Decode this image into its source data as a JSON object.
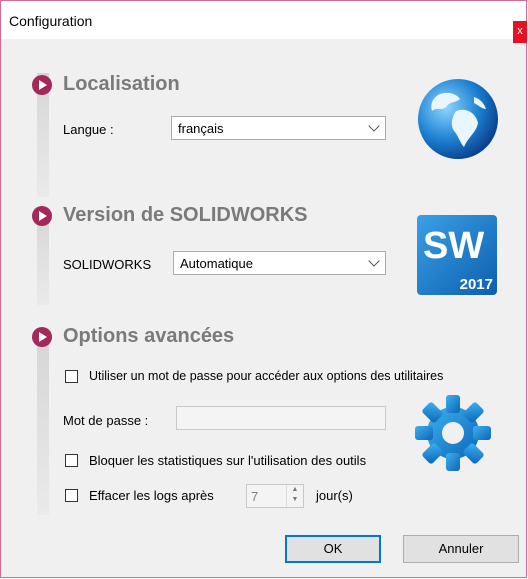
{
  "window": {
    "title": "Configuration",
    "close_symbol": "x"
  },
  "sections": {
    "localisation": {
      "heading": "Localisation",
      "label": "Langue :",
      "value": "français"
    },
    "version": {
      "heading": "Version de SOLIDWORKS",
      "label": "SOLIDWORKS",
      "value": "Automatique",
      "logo_text": "SW",
      "logo_year": "2017"
    },
    "advanced": {
      "heading": "Options avancées",
      "use_password_label": "Utiliser un mot de passe pour accéder aux options des utilitaires",
      "password_label": "Mot de passe :",
      "password_value": "",
      "block_stats_label": "Bloquer les statistiques sur l'utilisation des outils",
      "clear_logs_label": "Effacer les logs après",
      "days_value": "7",
      "days_unit": "jour(s)"
    }
  },
  "buttons": {
    "ok": "OK",
    "cancel": "Annuler"
  },
  "colors": {
    "accent": "#a4285a",
    "heading": "#7a7a7a",
    "focus": "#0078d7"
  }
}
